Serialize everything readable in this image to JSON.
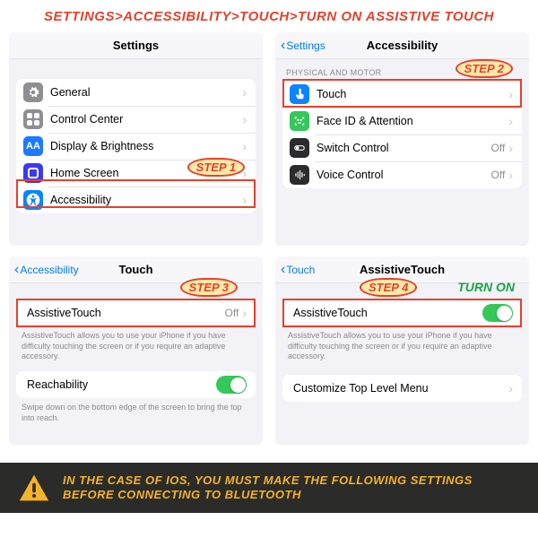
{
  "headline": "SETTINGS>ACCESSIBILITY>TOUCH>TURN ON ASSISTIVE TOUCH",
  "steps": {
    "s1": "STEP 1",
    "s2": "STEP 2",
    "s3": "STEP 3",
    "s4": "STEP 4",
    "turn_on": "TURN ON"
  },
  "panel1": {
    "title": "Settings",
    "rows": {
      "general": "General",
      "control": "Control Center",
      "display": "Display & Brightness",
      "home": "Home Screen",
      "access": "Accessibility"
    }
  },
  "panel2": {
    "back": "Settings",
    "title": "Accessibility",
    "section": "PHYSICAL AND MOTOR",
    "rows": {
      "touch": "Touch",
      "face": "Face ID & Attention",
      "switch": "Switch Control",
      "voice": "Voice Control"
    },
    "off": "Off"
  },
  "panel3": {
    "back": "Accessibility",
    "title": "Touch",
    "rows": {
      "assistive": "AssistiveTouch",
      "reach": "Reachability"
    },
    "off": "Off",
    "note_assistive": "AssistiveTouch allows you to use your iPhone if you have difficulty touching the screen or if you require an adaptive accessory.",
    "note_reach": "Swipe down on the bottom edge of the screen to bring the top into reach."
  },
  "panel4": {
    "back": "Touch",
    "title": "AssistiveTouch",
    "rows": {
      "assistive": "AssistiveTouch",
      "custom": "Customize Top Level Menu"
    },
    "note": "AssistiveTouch allows you to use your iPhone if you have difficulty touching the screen or if you require an adaptive accessory."
  },
  "banner": "IN THE CASE OF IOS, YOU MUST MAKE THE FOLLOWING SETTINGS BEFORE CONNECTING TO BLUETOOTH"
}
